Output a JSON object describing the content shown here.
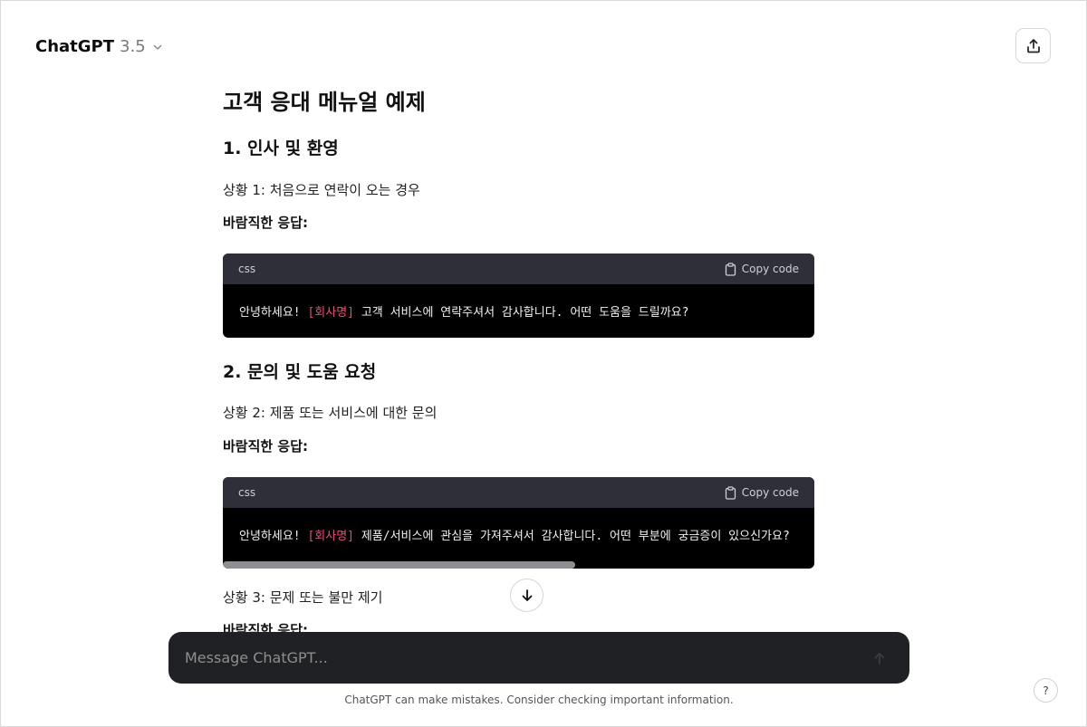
{
  "header": {
    "model_name": "ChatGPT",
    "model_version": "3.5"
  },
  "icons": {
    "model_chevron": "chevron-down-icon",
    "share": "share-upload-icon",
    "copy": "clipboard-icon",
    "scroll": "arrow-down-icon",
    "send": "arrow-up-icon"
  },
  "message": {
    "title": "고객 응대 메뉴얼 예제",
    "section1": {
      "heading": "1. 인사 및 환영",
      "situation": "상황 1: 처음으로 연락이 오는 경우",
      "response_label": "바람직한 응답:",
      "code": {
        "lang": "css",
        "copy_label": "Copy code",
        "text_before": "안녕하세요! ",
        "highlight": "[회사명]",
        "text_after": " 고객 서비스에 연락주셔서 감사합니다. 어떤 도움을 드릴까요?"
      }
    },
    "section2": {
      "heading": "2. 문의 및 도움 요청",
      "situation": "상황 2: 제품 또는 서비스에 대한 문의",
      "response_label": "바람직한 응답:",
      "code": {
        "lang": "css",
        "copy_label": "Copy code",
        "text_before": "안녕하세요! ",
        "highlight": "[회사명]",
        "text_after": " 제품/서비스에 관심을 가져주셔서 감사합니다. 어떤 부분에 궁금증이 있으신가요?"
      },
      "situation3": "상황 3: 문제 또는 불만 제기",
      "response_label_3": "바람직한 응답:"
    }
  },
  "composer": {
    "placeholder": "Message ChatGPT..."
  },
  "footer": {
    "disclaimer": "ChatGPT can make mistakes. Consider checking important information.",
    "help_label": "?"
  },
  "colors": {
    "code_header": "#2f2f3a",
    "code_body": "#000000",
    "highlight": "#e84d7a",
    "composer": "#202124"
  }
}
